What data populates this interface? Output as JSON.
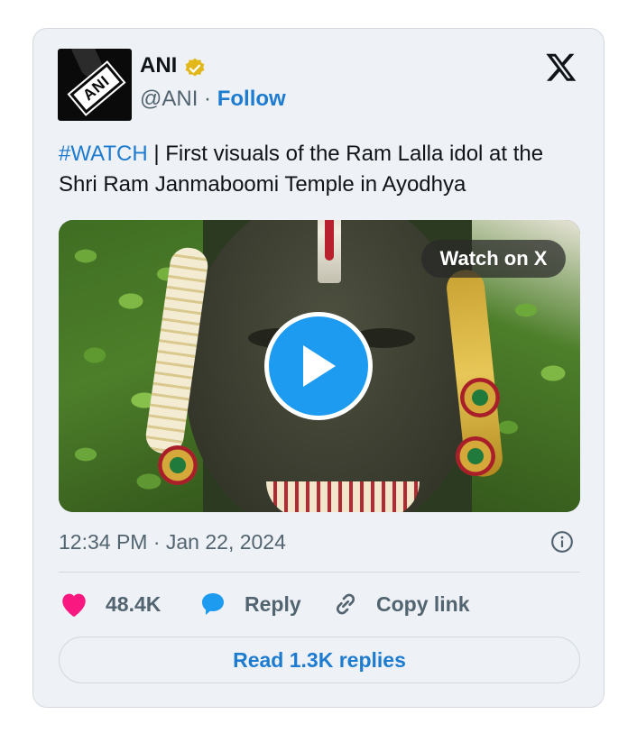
{
  "author": {
    "name": "ANI",
    "handle": "@ANI",
    "separator": "·",
    "follow_label": "Follow",
    "avatar_text": "ANI",
    "verified_color": "#e2b719"
  },
  "tweet": {
    "hashtag": "#WATCH",
    "text": " | First visuals of the Ram Lalla idol at the Shri Ram Janmaboomi Temple in Ayodhya"
  },
  "media": {
    "watch_label": "Watch on X",
    "play_color": "#1d9bf0"
  },
  "meta": {
    "timestamp": "12:34 PM · Jan 22, 2024"
  },
  "actions": {
    "like_count": "48.4K",
    "reply_label": "Reply",
    "copy_label": "Copy link",
    "like_color": "#f91880",
    "reply_color": "#1d9bf0"
  },
  "footer": {
    "read_replies_label": "Read 1.3K replies"
  }
}
